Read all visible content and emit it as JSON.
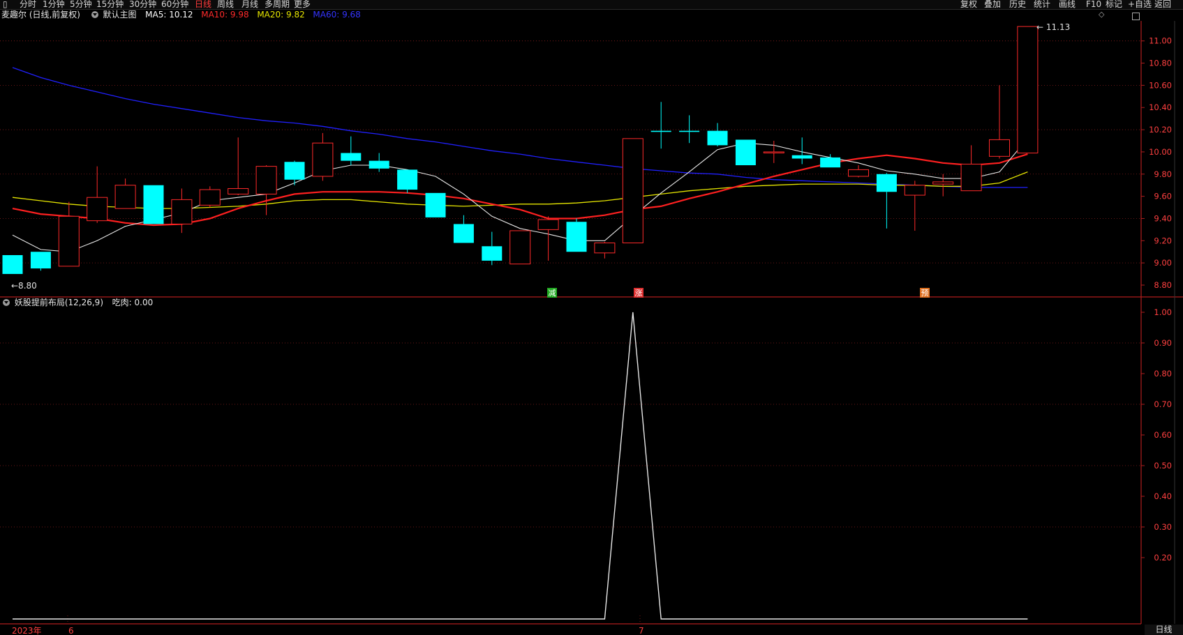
{
  "toolbar": {
    "left_items": [
      "分时",
      "1分钟",
      "5分钟",
      "15分钟",
      "30分钟",
      "60分钟",
      "日线",
      "周线",
      "月线",
      "多周期",
      "更多"
    ],
    "active_index": 6,
    "right_items": [
      "复权",
      "叠加",
      "历史",
      "统计",
      "画线",
      "F10",
      "标记",
      "+自选",
      "返回"
    ]
  },
  "main_panel": {
    "stock_label": "麦趣尔 (日线,前复权)",
    "template_label": "默认主图",
    "ma": [
      {
        "label": "MA5: 10.12",
        "color": "#ffffff"
      },
      {
        "label": "MA10: 9.98",
        "color": "#ff2a2a"
      },
      {
        "label": "MA20: 9.82",
        "color": "#e6e600"
      },
      {
        "label": "MA60: 9.68",
        "color": "#3434ff"
      }
    ],
    "high_marker": "11.13",
    "low_marker": "8.80",
    "signals": [
      {
        "text": "减",
        "color": "#22aa22"
      },
      {
        "text": "涨",
        "color": "#e03030"
      },
      {
        "text": "预",
        "color": "#e07020"
      }
    ],
    "y_ticks": [
      "11.00",
      "10.80",
      "10.60",
      "10.40",
      "10.20",
      "10.00",
      "9.80",
      "9.60",
      "9.40",
      "9.20",
      "9.00",
      "8.80"
    ]
  },
  "indicator_panel": {
    "label": "妖股提前布局(12,26,9)",
    "value_label": "吃肉: 0.00",
    "y_ticks": [
      "1.00",
      "0.90",
      "0.80",
      "0.70",
      "0.60",
      "0.50",
      "0.40",
      "0.30",
      "0.20"
    ]
  },
  "x_axis": {
    "labels": [
      "2023年",
      "6",
      "7"
    ]
  },
  "period_badge": "日线",
  "chart_data": {
    "type": "candlestick",
    "price_range": [
      8.78,
      11.14
    ],
    "candles": [
      {
        "o": 9.07,
        "h": 9.07,
        "l": 8.9,
        "c": 8.9
      },
      {
        "o": 9.1,
        "h": 9.1,
        "l": 8.93,
        "c": 8.95
      },
      {
        "o": 8.97,
        "h": 9.55,
        "l": 8.97,
        "c": 9.42
      },
      {
        "o": 9.38,
        "h": 9.87,
        "l": 9.36,
        "c": 9.59
      },
      {
        "o": 9.49,
        "h": 9.76,
        "l": 9.49,
        "c": 9.7
      },
      {
        "o": 9.7,
        "h": 9.7,
        "l": 9.35,
        "c": 9.35
      },
      {
        "o": 9.35,
        "h": 9.67,
        "l": 9.27,
        "c": 9.57
      },
      {
        "o": 9.52,
        "h": 9.69,
        "l": 9.5,
        "c": 9.66
      },
      {
        "o": 9.62,
        "h": 10.13,
        "l": 9.61,
        "c": 9.67
      },
      {
        "o": 9.62,
        "h": 9.88,
        "l": 9.43,
        "c": 9.87
      },
      {
        "o": 9.91,
        "h": 9.92,
        "l": 9.7,
        "c": 9.75
      },
      {
        "o": 9.78,
        "h": 10.17,
        "l": 9.74,
        "c": 10.08
      },
      {
        "o": 9.99,
        "h": 10.14,
        "l": 9.88,
        "c": 9.92
      },
      {
        "o": 9.92,
        "h": 9.99,
        "l": 9.82,
        "c": 9.85
      },
      {
        "o": 9.84,
        "h": 9.84,
        "l": 9.63,
        "c": 9.66
      },
      {
        "o": 9.63,
        "h": 9.63,
        "l": 9.41,
        "c": 9.41
      },
      {
        "o": 9.35,
        "h": 9.43,
        "l": 9.18,
        "c": 9.18
      },
      {
        "o": 9.15,
        "h": 9.28,
        "l": 8.98,
        "c": 9.02
      },
      {
        "o": 8.99,
        "h": 9.29,
        "l": 8.99,
        "c": 9.29
      },
      {
        "o": 9.3,
        "h": 9.42,
        "l": 9.02,
        "c": 9.39
      },
      {
        "o": 9.37,
        "h": 9.4,
        "l": 9.1,
        "c": 9.1
      },
      {
        "o": 9.09,
        "h": 9.19,
        "l": 9.04,
        "c": 9.18
      },
      {
        "o": 9.18,
        "h": 10.12,
        "l": 9.18,
        "c": 10.12
      },
      {
        "o": 10.19,
        "h": 10.45,
        "l": 10.03,
        "c": 10.18
      },
      {
        "o": 10.19,
        "h": 10.33,
        "l": 10.08,
        "c": 10.18
      },
      {
        "o": 10.19,
        "h": 10.26,
        "l": 10.05,
        "c": 10.06
      },
      {
        "o": 10.11,
        "h": 10.11,
        "l": 9.88,
        "c": 9.88
      },
      {
        "o": 10.0,
        "h": 10.1,
        "l": 9.9,
        "c": 10.0
      },
      {
        "o": 9.97,
        "h": 10.13,
        "l": 9.89,
        "c": 9.94
      },
      {
        "o": 9.95,
        "h": 9.98,
        "l": 9.86,
        "c": 9.86
      },
      {
        "o": 9.78,
        "h": 9.88,
        "l": 9.77,
        "c": 9.84
      },
      {
        "o": 9.8,
        "h": 9.81,
        "l": 9.31,
        "c": 9.64
      },
      {
        "o": 9.61,
        "h": 9.74,
        "l": 9.29,
        "c": 9.7
      },
      {
        "o": 9.71,
        "h": 9.8,
        "l": 9.6,
        "c": 9.73
      },
      {
        "o": 9.65,
        "h": 10.06,
        "l": 9.65,
        "c": 9.89
      },
      {
        "o": 9.96,
        "h": 10.6,
        "l": 9.94,
        "c": 10.11
      },
      {
        "o": 9.99,
        "h": 11.13,
        "l": 9.99,
        "c": 11.13
      }
    ],
    "ma5": [
      9.25,
      9.12,
      9.1,
      9.2,
      9.33,
      9.39,
      9.45,
      9.56,
      9.59,
      9.62,
      9.72,
      9.83,
      9.88,
      9.88,
      9.84,
      9.78,
      9.62,
      9.42,
      9.31,
      9.26,
      9.2,
      9.2,
      9.42,
      9.63,
      9.82,
      10.02,
      10.08,
      10.06,
      10.0,
      9.95,
      9.9,
      9.83,
      9.8,
      9.76,
      9.76,
      9.82,
      10.12
    ],
    "ma10": [
      9.49,
      9.44,
      9.42,
      9.4,
      9.36,
      9.34,
      9.35,
      9.4,
      9.49,
      9.56,
      9.62,
      9.64,
      9.64,
      9.64,
      9.63,
      9.61,
      9.58,
      9.53,
      9.48,
      9.4,
      9.4,
      9.43,
      9.48,
      9.51,
      9.58,
      9.64,
      9.71,
      9.78,
      9.84,
      9.9,
      9.94,
      9.97,
      9.94,
      9.9,
      9.88,
      9.9,
      9.98
    ],
    "ma20": [
      9.59,
      9.56,
      9.53,
      9.51,
      9.5,
      9.49,
      9.49,
      9.5,
      9.51,
      9.53,
      9.56,
      9.57,
      9.57,
      9.55,
      9.53,
      9.52,
      9.51,
      9.52,
      9.53,
      9.53,
      9.54,
      9.56,
      9.59,
      9.62,
      9.65,
      9.67,
      9.69,
      9.7,
      9.71,
      9.71,
      9.71,
      9.7,
      9.7,
      9.69,
      9.69,
      9.72,
      9.82
    ],
    "ma60": [
      10.76,
      10.67,
      10.6,
      10.54,
      10.48,
      10.43,
      10.39,
      10.35,
      10.31,
      10.28,
      10.26,
      10.23,
      10.19,
      10.16,
      10.12,
      10.09,
      10.05,
      10.01,
      9.98,
      9.94,
      9.91,
      9.88,
      9.85,
      9.83,
      9.81,
      9.8,
      9.77,
      9.75,
      9.74,
      9.73,
      9.72,
      9.71,
      9.7,
      9.69,
      9.68,
      9.68,
      9.68
    ],
    "indicator": [
      0,
      0,
      0,
      0,
      0,
      0,
      0,
      0,
      0,
      0,
      0,
      0,
      0,
      0,
      0,
      0,
      0,
      0,
      0,
      0,
      0,
      0,
      1,
      0,
      0,
      0,
      0,
      0,
      0,
      0,
      0,
      0,
      0,
      0,
      0,
      0,
      0
    ],
    "indicator_range": [
      0,
      1
    ]
  }
}
